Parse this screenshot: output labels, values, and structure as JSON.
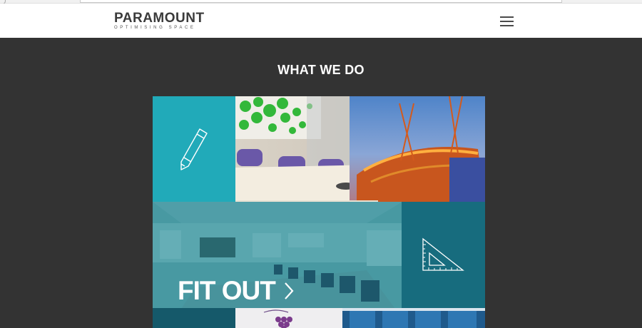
{
  "header": {
    "logo_main": "PARAMOUNT",
    "logo_sub": "OPTIMISING SPACE",
    "menu_icon": "hamburger-menu-icon"
  },
  "section": {
    "title": "WHAT WE DO"
  },
  "tiles": {
    "design_icon": "pencil-icon",
    "plan_icon": "set-square-icon",
    "fitout": {
      "label": "FIT OUT",
      "icon": "chevron-right-icon"
    }
  },
  "colors": {
    "page_bg": "#333333",
    "header_bg": "#ffffff",
    "teal_light": "#21aab9",
    "teal_dark": "#176c7e",
    "teal_deep": "#15596a"
  }
}
